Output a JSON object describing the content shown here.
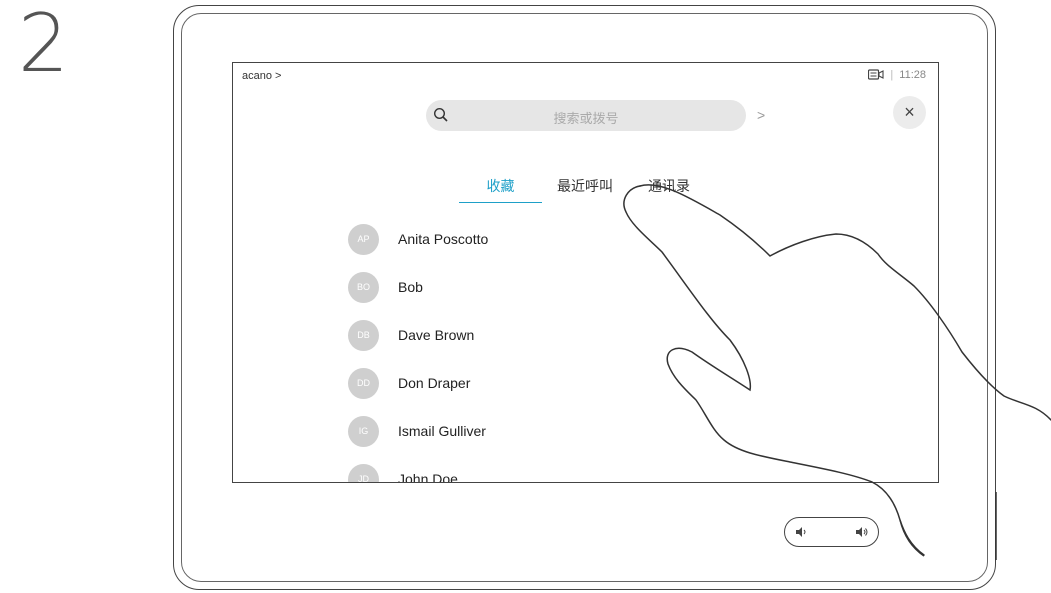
{
  "step": {
    "number": "2"
  },
  "header": {
    "breadcrumb": "acano >",
    "time": "11:28",
    "status_separator": "|"
  },
  "search": {
    "placeholder": "搜索或拨号",
    "arrow": ">"
  },
  "close": {
    "label": "×"
  },
  "tabs": [
    {
      "label": "收藏",
      "active": true
    },
    {
      "label": "最近呼叫",
      "active": false
    },
    {
      "label": "通讯录",
      "active": false
    }
  ],
  "contacts": [
    {
      "initials": "AP",
      "name": "Anita Poscotto"
    },
    {
      "initials": "BO",
      "name": "Bob"
    },
    {
      "initials": "DB",
      "name": "Dave Brown"
    },
    {
      "initials": "DD",
      "name": "Don Draper"
    },
    {
      "initials": "IG",
      "name": "Ismail Gulliver"
    },
    {
      "initials": "JD",
      "name": "John Doe"
    }
  ],
  "icons": {
    "camera": "camera-icon",
    "search": "search-icon",
    "volume_down": "volume-down-icon",
    "volume_up": "volume-up-icon"
  },
  "colors": {
    "accent": "#1ea0c8",
    "avatar": "#cfcfcf",
    "search_bg": "#e6e6e6"
  }
}
